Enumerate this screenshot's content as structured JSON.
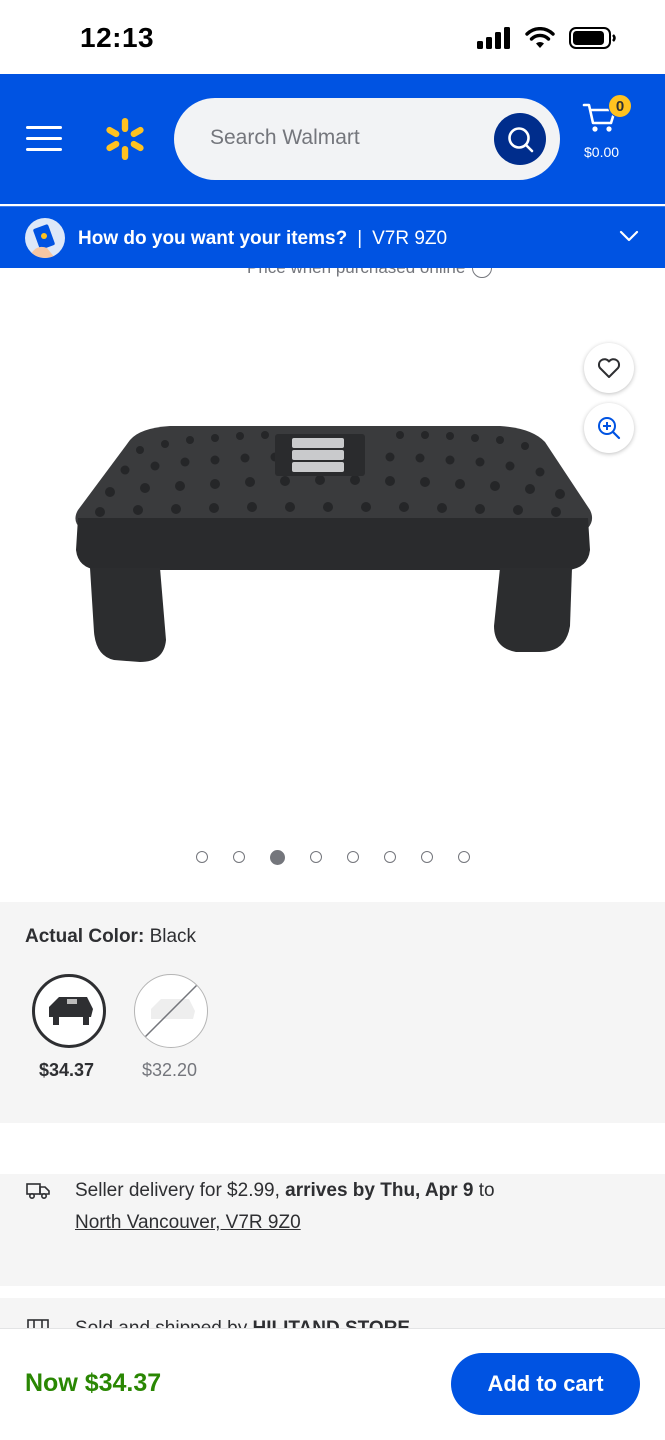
{
  "status_bar": {
    "time": "12:13"
  },
  "header": {
    "search_placeholder": "Search Walmart",
    "cart_count": "0",
    "cart_total": "$0.00"
  },
  "intent_bar": {
    "question": "How do you want your items?",
    "separator": "|",
    "zip": "V7R 9Z0"
  },
  "price_peek": {
    "note": "Price when purchased online"
  },
  "carousel": {
    "total": 8,
    "active_index": 2
  },
  "variants": {
    "label": "Actual Color:",
    "selected_value": "Black",
    "options": [
      {
        "price": "$34.37",
        "state": "selected"
      },
      {
        "price": "$32.20",
        "state": "unavailable"
      }
    ]
  },
  "delivery": {
    "prefix": "Seller delivery for $2.99, ",
    "arrival": "arrives by Thu, Apr 9",
    "suffix": " to",
    "location": "North Vancouver, V7R 9Z0"
  },
  "seller": {
    "prefix": "Sold and shipped by ",
    "name": "HILITAND STORE"
  },
  "bottom_bar": {
    "now_price": "Now $34.37",
    "add_to_cart_label": "Add to cart"
  },
  "colors": {
    "brand_blue": "#0053e2",
    "spark_yellow": "#ffc220",
    "price_green": "#2a8703"
  }
}
